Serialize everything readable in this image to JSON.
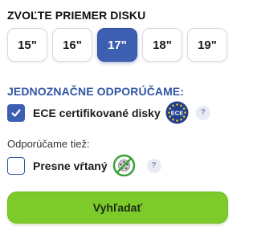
{
  "disk_selector": {
    "title": "ZVOĽTE PRIEMER DISKU",
    "sizes": [
      {
        "label": "15\""
      },
      {
        "label": "16\""
      },
      {
        "label": "17\"",
        "selected": true
      },
      {
        "label": "18\""
      },
      {
        "label": "19\""
      }
    ]
  },
  "recommend": {
    "title": "JEDNOZNAČNE ODPORÚČAME:",
    "ece": {
      "label": "ECE certifikované disky",
      "checked": true,
      "badge_text": "ECE",
      "help": "?"
    }
  },
  "also": {
    "title": "Odporúčame tiež:",
    "exact": {
      "label": "Presne vŕtaný",
      "checked": false,
      "help": "?"
    }
  },
  "search_button": {
    "label": "Vyhľadať"
  },
  "colors": {
    "accent": "#3d5fb2",
    "heading_blue": "#2f55a4",
    "search_green": "#7ccb2a"
  }
}
